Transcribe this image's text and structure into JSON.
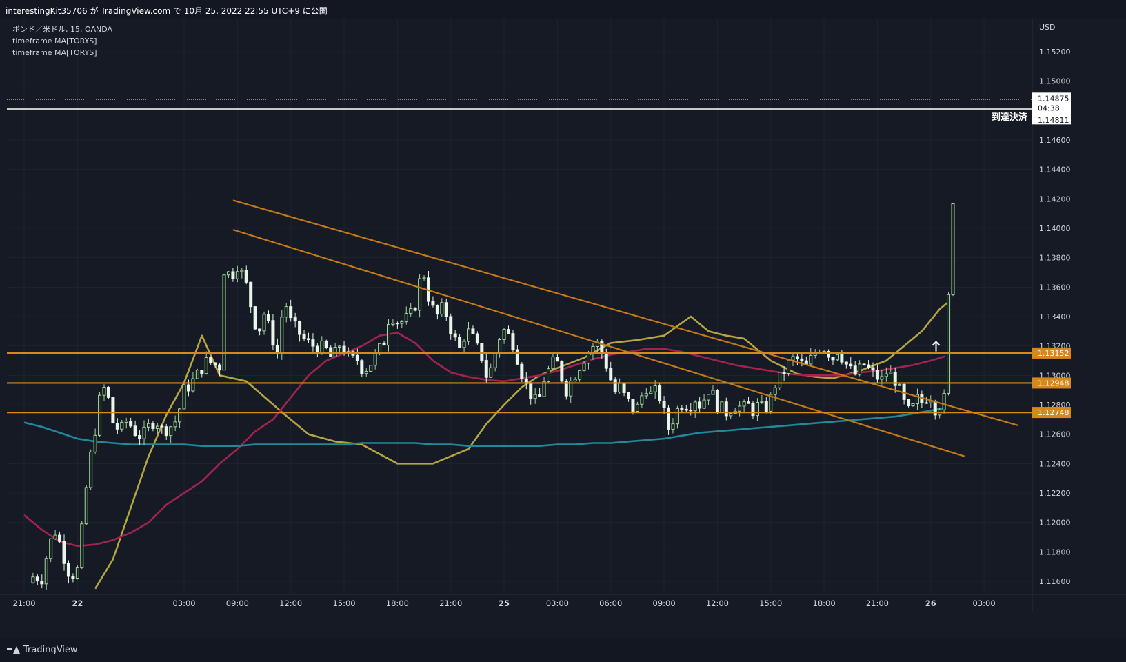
{
  "header": {
    "publish_text": "interestingKit35706 が TradingView.com で 10月 25, 2022 22:55 UTC+9 に公開"
  },
  "legend": {
    "symbol": "ポンド／米ドル, 15, OANDA",
    "indicator_1": "timeframe MA[TORYS]",
    "indicator_2": "timeframe MA[TORYS]"
  },
  "footer": {
    "brand": "TradingView"
  },
  "colors": {
    "background": "#161a25",
    "up_candle": "#a5d6a7",
    "down_candle": "#e8f5e9",
    "ma_fast": "#b5a642",
    "ma_mid": "#a3234f",
    "ma_slow": "#1f8a9b",
    "trend_line": "#c67a14",
    "level_line": "#d6891a",
    "target_line": "#c8c8c8"
  },
  "chart_data": {
    "type": "candlestick",
    "symbol": "ポンド／米ドル",
    "interval": "15",
    "source": "OANDA",
    "currency_label": "USD",
    "ylim": [
      1.1155,
      1.1575
    ],
    "y_ticks": [
      "1.11600",
      "1.11800",
      "1.12000",
      "1.12200",
      "1.12400",
      "1.12600",
      "1.12800",
      "1.13000",
      "1.13200",
      "1.13400",
      "1.13600",
      "1.13800",
      "1.14000",
      "1.14200",
      "1.14400",
      "1.14600",
      "1.15000",
      "1.15200"
    ],
    "x_ticks": [
      "21:00",
      "22",
      "03:00",
      "09:00",
      "12:00",
      "15:00",
      "18:00",
      "21:00",
      "25",
      "03:00",
      "06:00",
      "09:00",
      "12:00",
      "15:00",
      "18:00",
      "21:00",
      "26",
      "03:00"
    ],
    "x_tick_hours": [
      21,
      24,
      30,
      33,
      36,
      39,
      42,
      45,
      48,
      51,
      54,
      57,
      60,
      63,
      66,
      69,
      72,
      75
    ],
    "x_day_ticks": [
      "22",
      "24",
      "25",
      "26"
    ],
    "x_day_tick_hours": [
      24,
      33,
      51,
      75
    ],
    "last_hour": 72.75,
    "horizontal_levels": [
      {
        "price": 1.13152,
        "label": "1.13152"
      },
      {
        "price": 1.12948,
        "label": "1.12948"
      },
      {
        "price": 1.12748,
        "label": "1.12748"
      }
    ],
    "target_level": {
      "price": 1.14811,
      "label": "1.14811",
      "annotation": "到達決済"
    },
    "last_price": {
      "price": 1.14875,
      "label": "1.14875",
      "countdown": "04:38"
    },
    "trend_lines": [
      {
        "from": [
          32.75,
          1.1419
        ],
        "to": [
          76.9,
          1.1266
        ]
      },
      {
        "from": [
          32.75,
          1.1399
        ],
        "to": [
          73.9,
          1.1245
        ]
      }
    ],
    "moving_averages": [
      {
        "key": "fast",
        "points": [
          [
            25.0,
            1.1155
          ],
          [
            26.0,
            1.1175
          ],
          [
            27.0,
            1.121
          ],
          [
            28.0,
            1.1245
          ],
          [
            29.0,
            1.1273
          ],
          [
            30.0,
            1.1295
          ],
          [
            31.0,
            1.1327
          ],
          [
            32.0,
            1.13
          ],
          [
            33.5,
            1.1296
          ],
          [
            35.5,
            1.1275
          ],
          [
            37.0,
            1.126
          ],
          [
            38.5,
            1.1255
          ],
          [
            40.0,
            1.1253
          ],
          [
            42.0,
            1.124
          ],
          [
            44.0,
            1.124
          ],
          [
            45.0,
            1.1245
          ],
          [
            46.0,
            1.125
          ],
          [
            47.0,
            1.1267
          ],
          [
            48.0,
            1.128
          ],
          [
            49.0,
            1.1292
          ],
          [
            50.0,
            1.13
          ],
          [
            51.0,
            1.1305
          ],
          [
            52.5,
            1.1312
          ],
          [
            54.0,
            1.1322
          ],
          [
            55.5,
            1.1324
          ],
          [
            57.0,
            1.1327
          ],
          [
            58.5,
            1.134
          ],
          [
            59.5,
            1.133
          ],
          [
            60.5,
            1.1327
          ],
          [
            61.5,
            1.1325
          ],
          [
            63.0,
            1.131
          ],
          [
            64.5,
            1.1301
          ],
          [
            65.5,
            1.1299
          ],
          [
            66.5,
            1.1298
          ],
          [
            68.0,
            1.1303
          ],
          [
            69.5,
            1.131
          ],
          [
            70.5,
            1.132
          ],
          [
            71.5,
            1.133
          ],
          [
            72.5,
            1.1345
          ],
          [
            73.0,
            1.135
          ]
        ]
      },
      {
        "key": "mid",
        "points": [
          [
            21.0,
            1.1205
          ],
          [
            22.0,
            1.1195
          ],
          [
            23.0,
            1.1187
          ],
          [
            24.0,
            1.1184
          ],
          [
            25.0,
            1.1185
          ],
          [
            26.0,
            1.1188
          ],
          [
            27.0,
            1.1193
          ],
          [
            28.0,
            1.12
          ],
          [
            29.0,
            1.1212
          ],
          [
            30.0,
            1.122
          ],
          [
            31.0,
            1.1228
          ],
          [
            32.0,
            1.124
          ],
          [
            33.0,
            1.125
          ],
          [
            34.0,
            1.1262
          ],
          [
            35.0,
            1.127
          ],
          [
            36.0,
            1.1285
          ],
          [
            37.0,
            1.13
          ],
          [
            38.0,
            1.131
          ],
          [
            39.0,
            1.1315
          ],
          [
            40.0,
            1.132
          ],
          [
            41.0,
            1.1327
          ],
          [
            42.0,
            1.1329
          ],
          [
            43.0,
            1.1322
          ],
          [
            44.0,
            1.131
          ],
          [
            45.0,
            1.1302
          ],
          [
            46.0,
            1.1299
          ],
          [
            47.0,
            1.1297
          ],
          [
            48.0,
            1.1296
          ],
          [
            49.0,
            1.1298
          ],
          [
            50.0,
            1.13
          ],
          [
            51.0,
            1.1303
          ],
          [
            52.0,
            1.1307
          ],
          [
            53.0,
            1.1311
          ],
          [
            54.0,
            1.1314
          ],
          [
            55.0,
            1.1316
          ],
          [
            56.0,
            1.1318
          ],
          [
            57.0,
            1.1318
          ],
          [
            58.0,
            1.1316
          ],
          [
            59.0,
            1.1313
          ],
          [
            60.0,
            1.131
          ],
          [
            61.0,
            1.1307
          ],
          [
            62.0,
            1.1305
          ],
          [
            63.0,
            1.1303
          ],
          [
            64.0,
            1.1301
          ],
          [
            65.0,
            1.13
          ],
          [
            66.0,
            1.13
          ],
          [
            67.0,
            1.13
          ],
          [
            68.0,
            1.1302
          ],
          [
            69.0,
            1.1303
          ],
          [
            70.0,
            1.1305
          ],
          [
            71.0,
            1.1307
          ],
          [
            72.0,
            1.131
          ],
          [
            72.8,
            1.1313
          ]
        ]
      },
      {
        "key": "slow",
        "points": [
          [
            21.0,
            1.1268
          ],
          [
            22.0,
            1.1265
          ],
          [
            23.0,
            1.1261
          ],
          [
            24.0,
            1.1257
          ],
          [
            25.0,
            1.1255
          ],
          [
            26.0,
            1.1254
          ],
          [
            27.0,
            1.1253
          ],
          [
            28.0,
            1.1253
          ],
          [
            29.0,
            1.1253
          ],
          [
            30.0,
            1.1253
          ],
          [
            31.0,
            1.1252
          ],
          [
            32.0,
            1.1252
          ],
          [
            33.0,
            1.1252
          ],
          [
            34.0,
            1.1253
          ],
          [
            35.0,
            1.1253
          ],
          [
            36.0,
            1.1253
          ],
          [
            37.0,
            1.1253
          ],
          [
            38.0,
            1.1253
          ],
          [
            39.0,
            1.1253
          ],
          [
            40.0,
            1.1254
          ],
          [
            41.0,
            1.1254
          ],
          [
            42.0,
            1.1254
          ],
          [
            43.0,
            1.1254
          ],
          [
            44.0,
            1.1253
          ],
          [
            45.0,
            1.1253
          ],
          [
            46.0,
            1.1252
          ],
          [
            47.0,
            1.1252
          ],
          [
            48.0,
            1.1252
          ],
          [
            49.0,
            1.1252
          ],
          [
            50.0,
            1.1252
          ],
          [
            51.0,
            1.1253
          ],
          [
            52.0,
            1.1253
          ],
          [
            53.0,
            1.1254
          ],
          [
            54.0,
            1.1254
          ],
          [
            55.0,
            1.1255
          ],
          [
            56.0,
            1.1256
          ],
          [
            57.0,
            1.1257
          ],
          [
            58.0,
            1.1259
          ],
          [
            59.0,
            1.1261
          ],
          [
            60.0,
            1.1262
          ],
          [
            61.0,
            1.1263
          ],
          [
            62.0,
            1.1264
          ],
          [
            63.0,
            1.1265
          ],
          [
            64.0,
            1.1266
          ],
          [
            65.0,
            1.1267
          ],
          [
            66.0,
            1.1268
          ],
          [
            67.0,
            1.1269
          ],
          [
            68.0,
            1.127
          ],
          [
            69.0,
            1.1271
          ],
          [
            70.0,
            1.1272
          ],
          [
            71.0,
            1.1274
          ],
          [
            72.0,
            1.1276
          ],
          [
            72.8,
            1.1278
          ]
        ]
      }
    ],
    "price_path": [
      [
        21.5,
        1.1163
      ],
      [
        22.0,
        1.1162
      ],
      [
        22.4,
        1.1185
      ],
      [
        22.8,
        1.1195
      ],
      [
        23.2,
        1.1178
      ],
      [
        23.6,
        1.1163
      ],
      [
        24.0,
        1.1168
      ],
      [
        24.3,
        1.12
      ],
      [
        24.6,
        1.1235
      ],
      [
        25.0,
        1.1263
      ],
      [
        25.3,
        1.1287
      ],
      [
        25.6,
        1.1293
      ],
      [
        26.0,
        1.1268
      ],
      [
        26.4,
        1.1262
      ],
      [
        26.8,
        1.127
      ],
      [
        27.2,
        1.1262
      ],
      [
        27.6,
        1.1258
      ],
      [
        28.0,
        1.1265
      ],
      [
        28.4,
        1.127
      ],
      [
        28.8,
        1.1262
      ],
      [
        29.2,
        1.1265
      ],
      [
        29.6,
        1.127
      ],
      [
        30.0,
        1.129
      ],
      [
        30.3,
        1.1293
      ],
      [
        30.6,
        1.1298
      ],
      [
        31.0,
        1.1305
      ],
      [
        31.3,
        1.131
      ],
      [
        31.6,
        1.1308
      ],
      [
        32.0,
        1.1306
      ],
      [
        32.2,
        1.1372
      ],
      [
        32.4,
        1.137
      ],
      [
        32.7,
        1.1368
      ],
      [
        33.0,
        1.1375
      ],
      [
        33.3,
        1.1368
      ],
      [
        33.6,
        1.1358
      ],
      [
        33.9,
        1.1338
      ],
      [
        34.2,
        1.133
      ],
      [
        34.5,
        1.1342
      ],
      [
        34.8,
        1.1332
      ],
      [
        35.1,
        1.132
      ],
      [
        35.4,
        1.131
      ],
      [
        35.6,
        1.137
      ],
      [
        35.8,
        1.134
      ],
      [
        36.1,
        1.1335
      ],
      [
        36.4,
        1.133
      ],
      [
        36.7,
        1.1325
      ],
      [
        37.0,
        1.1322
      ],
      [
        37.3,
        1.132
      ],
      [
        37.6,
        1.1318
      ],
      [
        37.9,
        1.132
      ],
      [
        38.2,
        1.1312
      ],
      [
        38.5,
        1.1315
      ],
      [
        38.8,
        1.1322
      ],
      [
        39.1,
        1.1315
      ],
      [
        39.4,
        1.131
      ],
      [
        39.7,
        1.1312
      ],
      [
        40.0,
        1.1305
      ],
      [
        40.3,
        1.1305
      ],
      [
        40.6,
        1.131
      ],
      [
        40.9,
        1.1317
      ],
      [
        41.2,
        1.132
      ],
      [
        41.5,
        1.1338
      ],
      [
        41.8,
        1.134
      ],
      [
        42.1,
        1.1335
      ],
      [
        42.4,
        1.1338
      ],
      [
        42.7,
        1.134
      ],
      [
        43.0,
        1.1348
      ],
      [
        43.2,
        1.136
      ],
      [
        43.4,
        1.1375
      ],
      [
        43.7,
        1.1355
      ],
      [
        44.0,
        1.1345
      ],
      [
        44.3,
        1.134
      ],
      [
        44.6,
        1.1348
      ],
      [
        44.9,
        1.1335
      ],
      [
        45.2,
        1.1325
      ],
      [
        45.5,
        1.1318
      ],
      [
        45.8,
        1.1328
      ],
      [
        46.1,
        1.133
      ],
      [
        46.4,
        1.132
      ],
      [
        46.7,
        1.1315
      ],
      [
        47.0,
        1.13
      ],
      [
        47.3,
        1.1305
      ],
      [
        47.6,
        1.132
      ],
      [
        47.9,
        1.1332
      ],
      [
        48.2,
        1.1328
      ],
      [
        48.5,
        1.1322
      ],
      [
        48.8,
        1.131
      ],
      [
        49.1,
        1.1297
      ],
      [
        49.4,
        1.129
      ],
      [
        49.7,
        1.1282
      ],
      [
        50.0,
        1.1285
      ],
      [
        50.3,
        1.13
      ],
      [
        50.6,
        1.1305
      ],
      [
        50.9,
        1.1312
      ],
      [
        51.2,
        1.13
      ],
      [
        51.5,
        1.129
      ],
      [
        51.8,
        1.1297
      ],
      [
        52.1,
        1.1303
      ],
      [
        52.4,
        1.131
      ],
      [
        52.7,
        1.1315
      ],
      [
        53.0,
        1.132
      ],
      [
        53.3,
        1.1322
      ],
      [
        53.6,
        1.1312
      ],
      [
        53.9,
        1.1302
      ],
      [
        54.2,
        1.1288
      ],
      [
        54.5,
        1.1292
      ],
      [
        54.8,
        1.1285
      ],
      [
        55.1,
        1.128
      ],
      [
        55.4,
        1.1275
      ],
      [
        55.7,
        1.1285
      ],
      [
        56.0,
        1.1292
      ],
      [
        56.3,
        1.1286
      ],
      [
        56.6,
        1.129
      ],
      [
        56.9,
        1.128
      ],
      [
        57.2,
        1.1263
      ],
      [
        57.5,
        1.127
      ],
      [
        57.8,
        1.1278
      ],
      [
        58.1,
        1.1282
      ],
      [
        58.4,
        1.1278
      ],
      [
        58.7,
        1.1285
      ],
      [
        59.0,
        1.128
      ],
      [
        59.3,
        1.1285
      ],
      [
        59.6,
        1.1293
      ],
      [
        59.9,
        1.128
      ],
      [
        60.2,
        1.1278
      ],
      [
        60.5,
        1.1275
      ],
      [
        60.8,
        1.1278
      ],
      [
        61.1,
        1.128
      ],
      [
        61.4,
        1.1277
      ],
      [
        61.7,
        1.128
      ],
      [
        62.0,
        1.1276
      ],
      [
        62.3,
        1.128
      ],
      [
        62.6,
        1.1277
      ],
      [
        62.9,
        1.128
      ],
      [
        63.2,
        1.1293
      ],
      [
        63.5,
        1.1298
      ],
      [
        63.8,
        1.1304
      ],
      [
        64.1,
        1.131
      ],
      [
        64.4,
        1.1312
      ],
      [
        64.7,
        1.1308
      ],
      [
        65.0,
        1.1306
      ],
      [
        65.3,
        1.1312
      ],
      [
        65.6,
        1.1318
      ],
      [
        65.9,
        1.132
      ],
      [
        66.2,
        1.1316
      ],
      [
        66.5,
        1.1312
      ],
      [
        66.8,
        1.1318
      ],
      [
        67.1,
        1.131
      ],
      [
        67.4,
        1.1305
      ],
      [
        67.7,
        1.13
      ],
      [
        68.0,
        1.1304
      ],
      [
        68.3,
        1.1308
      ],
      [
        68.6,
        1.1302
      ],
      [
        68.9,
        1.13
      ],
      [
        69.2,
        1.1296
      ],
      [
        69.5,
        1.1302
      ],
      [
        69.8,
        1.13
      ],
      [
        70.1,
        1.1295
      ],
      [
        70.4,
        1.1284
      ],
      [
        70.7,
        1.1275
      ],
      [
        71.0,
        1.1278
      ],
      [
        71.3,
        1.1285
      ],
      [
        71.6,
        1.128
      ],
      [
        71.9,
        1.129
      ],
      [
        72.2,
        1.1277
      ],
      [
        72.5,
        1.128
      ],
      [
        72.8,
        1.1285
      ]
    ]
  }
}
